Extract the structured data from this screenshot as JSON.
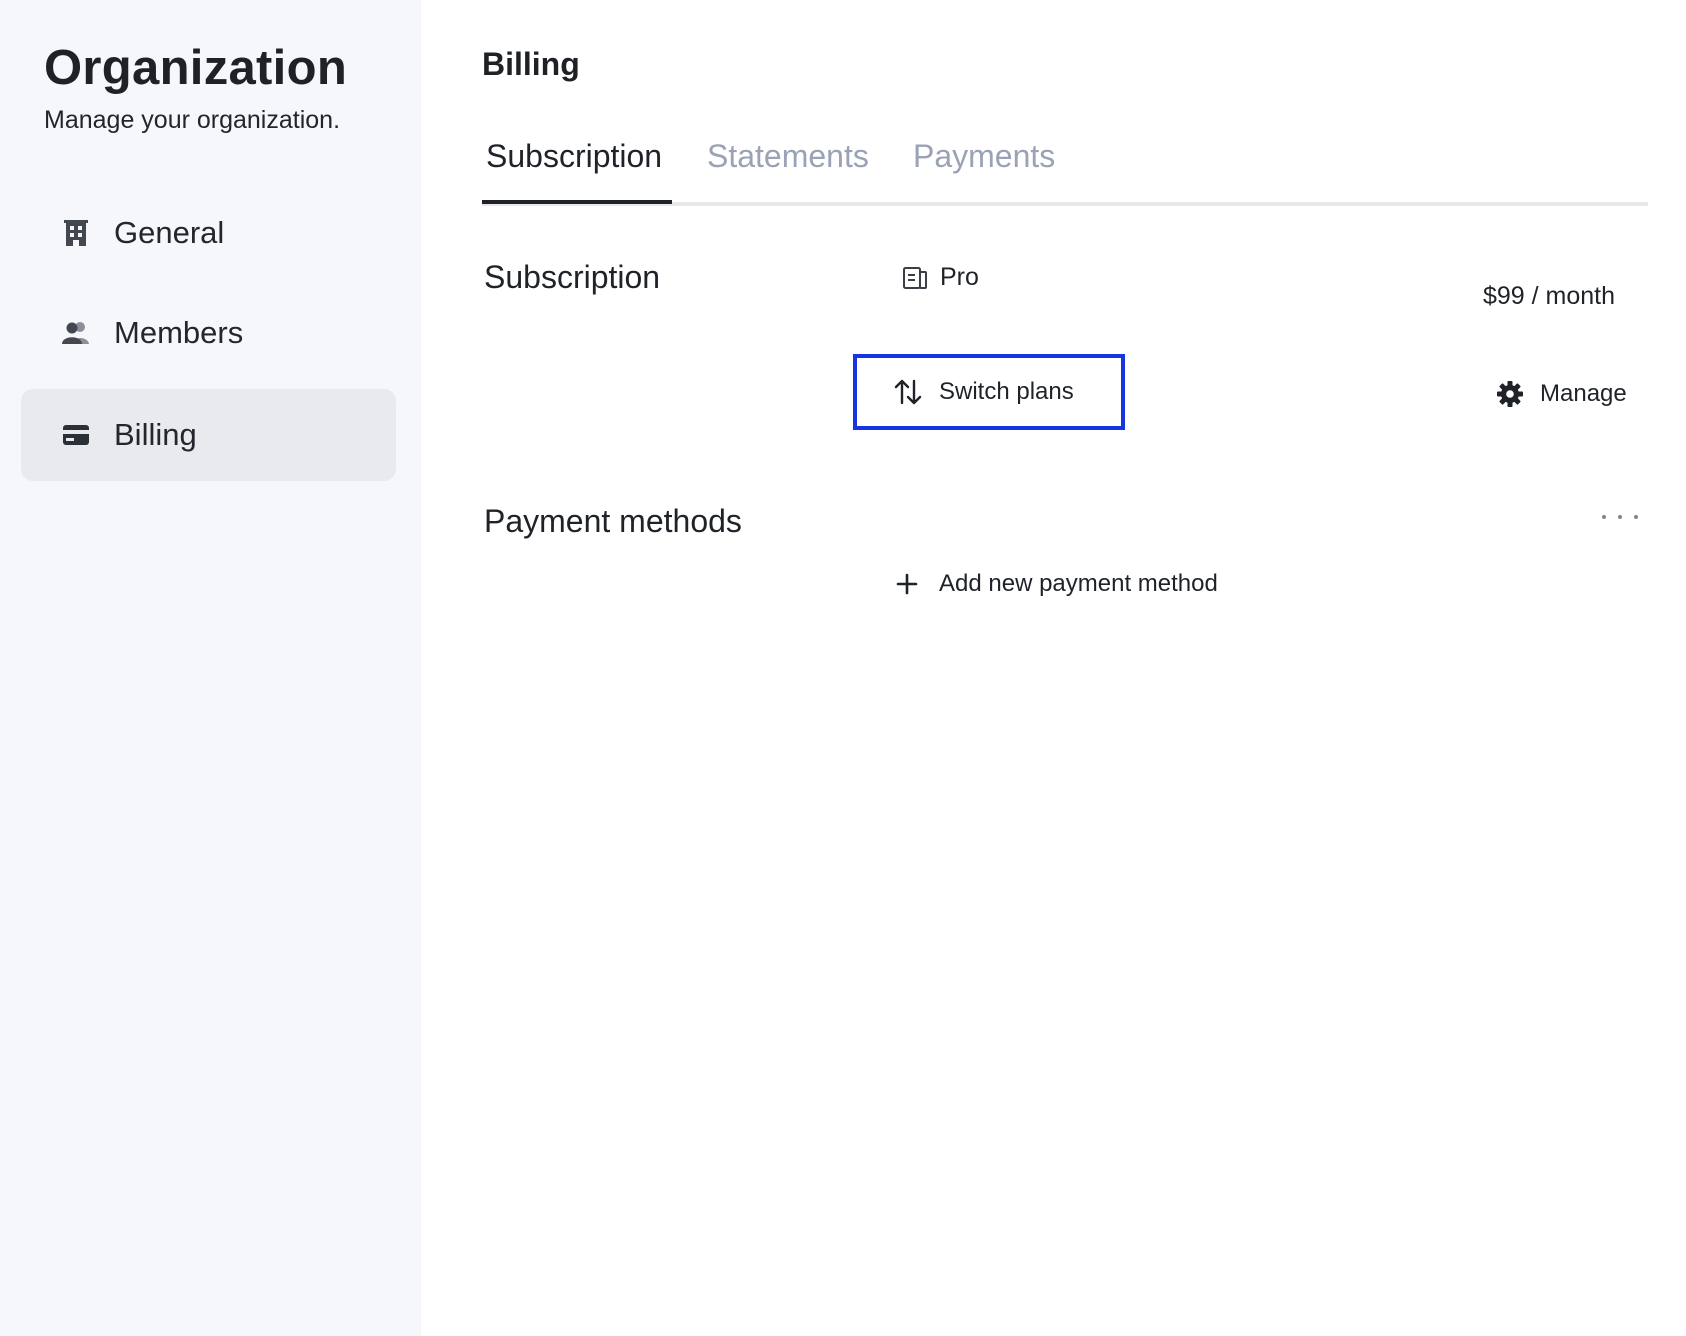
{
  "sidebar": {
    "title": "Organization",
    "subtitle": "Manage your organization.",
    "items": [
      {
        "label": "General",
        "icon": "building-icon",
        "active": false
      },
      {
        "label": "Members",
        "icon": "members-icon",
        "active": false
      },
      {
        "label": "Billing",
        "icon": "credit-card-icon",
        "active": true
      }
    ]
  },
  "main": {
    "page_title": "Billing",
    "tabs": [
      {
        "label": "Subscription",
        "active": true
      },
      {
        "label": "Statements",
        "active": false
      },
      {
        "label": "Payments",
        "active": false
      }
    ],
    "subscription": {
      "section_title": "Subscription",
      "plan_name": "Pro",
      "plan_icon": "plan-document-icon",
      "price": "$99 / month",
      "switch_plans_label": "Switch plans",
      "switch_plans_icon": "switch-arrows-icon",
      "manage_label": "Manage",
      "manage_icon": "gear-icon"
    },
    "payment_methods": {
      "section_title": "Payment methods",
      "more_icon": "more-dots-icon",
      "add_label": "Add new payment method",
      "add_icon": "plus-icon"
    }
  },
  "colors": {
    "sidebar_bg": "#f5f7fb",
    "active_nav_bg": "#e8eaee",
    "tab_inactive": "#9aa3b5",
    "focus_outline": "#1634e0",
    "text_primary": "#1f2329"
  }
}
